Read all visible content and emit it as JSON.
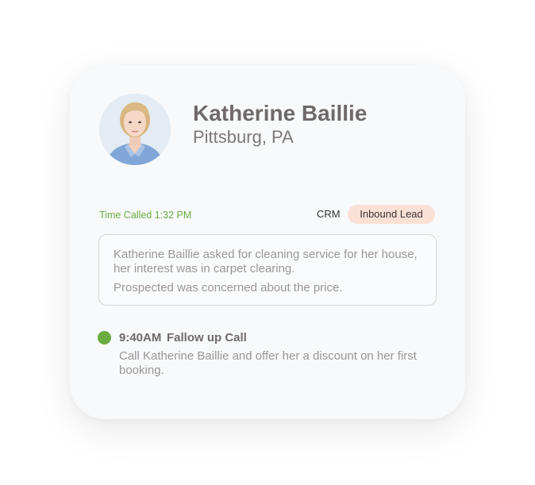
{
  "contact": {
    "name": "Katherine Baillie",
    "location": "Pittsburg, PA",
    "avatar_icon": "person-photo"
  },
  "call": {
    "time_called": "Time Called 1:32 PM",
    "source_label": "CRM",
    "lead_badge": "Inbound Lead",
    "notes": [
      "Katherine Baillie asked for cleaning service for her house, her interest was in carpet clearing.",
      "Prospected was concerned about the price."
    ]
  },
  "followup": {
    "time": "9:40AM",
    "title": "Fallow up Call",
    "description": "Call Katherine Baillie and offer her a discount on her first booking.",
    "status_color": "#6aac3f"
  },
  "colors": {
    "accent_green": "#6aac3f",
    "badge_bg": "#fbe0d5",
    "card_bg": "#f8f9fb"
  }
}
